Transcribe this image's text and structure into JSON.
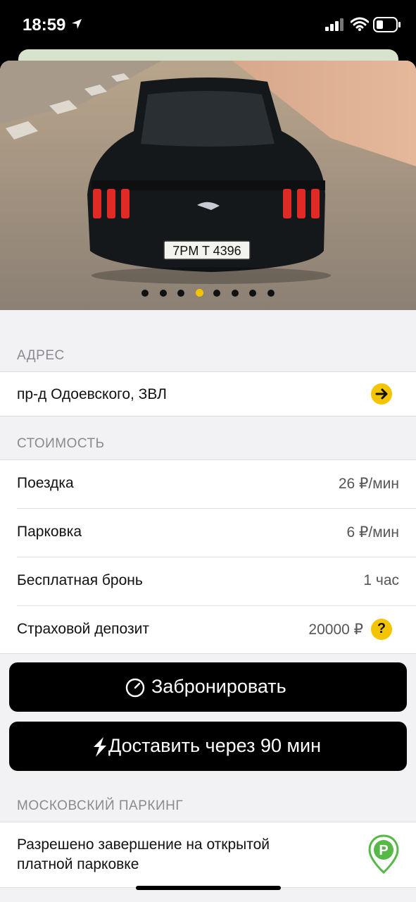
{
  "status_bar": {
    "time": "18:59"
  },
  "photo": {
    "plate": "7PM T 4396",
    "pages": 8,
    "active_page_index": 3
  },
  "address": {
    "header": "АДРЕС",
    "text": "пр-д Одоевского, ЗВЛ",
    "nav_icon": "arrow-right-icon"
  },
  "cost": {
    "header": "СТОИМОСТЬ",
    "rows": [
      {
        "label": "Поездка",
        "value": "26 ₽/мин"
      },
      {
        "label": "Парковка",
        "value": "6 ₽/мин"
      },
      {
        "label": "Бесплатная бронь",
        "value": "1 час"
      },
      {
        "label": "Страховой депозит",
        "value": "20000 ₽"
      }
    ],
    "help_icon": "question-icon",
    "help_glyph": "?"
  },
  "buttons": {
    "book_label": "Забронировать",
    "book_icon": "clock-icon",
    "deliver_label": "Доставить через 90 мин",
    "deliver_icon": "lightning-icon"
  },
  "parking": {
    "header": "МОСКОВСКИЙ ПАРКИНГ",
    "line1": "Разрешено завершение на открытой",
    "line2": "платной парковке",
    "icon": "parking-pin-icon",
    "icon_letter": "P"
  },
  "colors": {
    "accent": "#f5c400",
    "parking_green": "#56b947"
  }
}
